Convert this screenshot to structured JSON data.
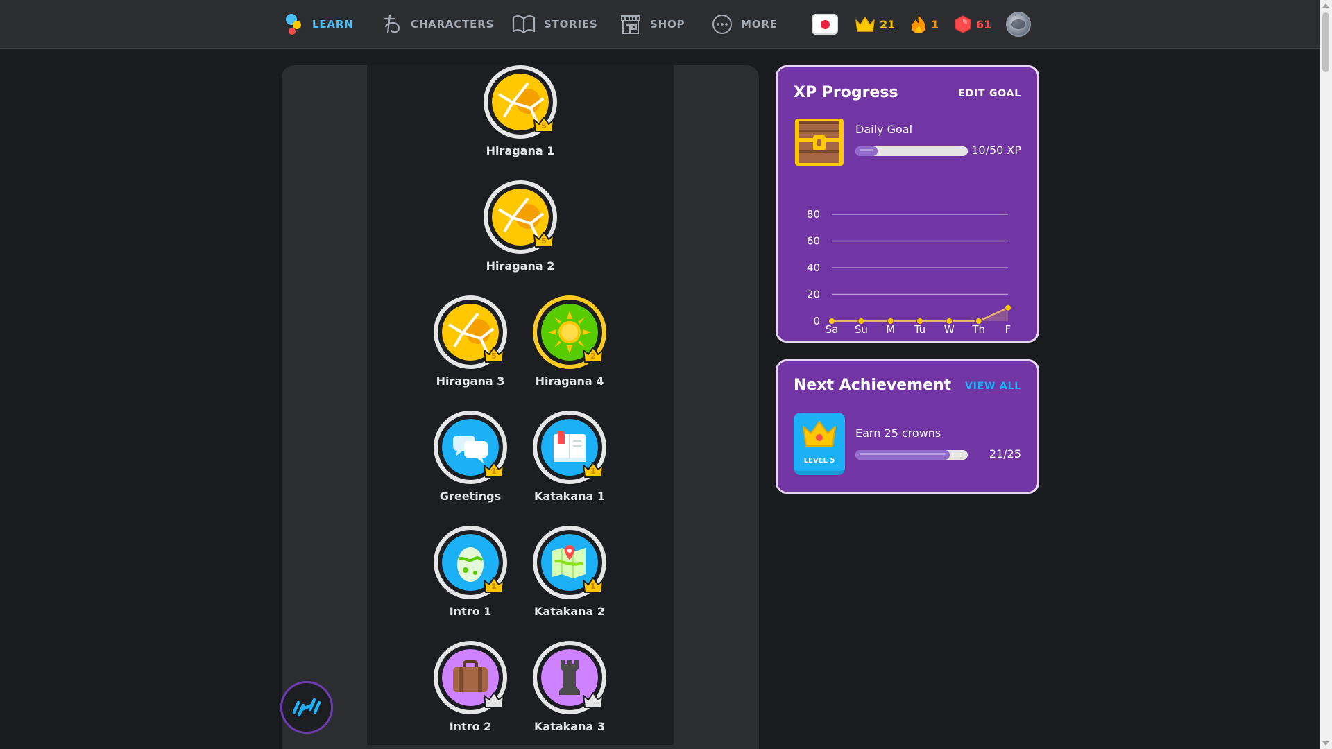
{
  "nav": {
    "items": [
      {
        "label": "LEARN",
        "icon": "learn-icon"
      },
      {
        "label": "CHARACTERS",
        "icon": "characters-icon"
      },
      {
        "label": "STORIES",
        "icon": "stories-icon"
      },
      {
        "label": "SHOP",
        "icon": "shop-icon"
      },
      {
        "label": "MORE",
        "icon": "more-icon"
      }
    ],
    "active": "LEARN",
    "language_flag": "japan-flag-icon",
    "crowns": "21",
    "streak": "1",
    "gems": "61"
  },
  "colors": {
    "active_nav": "#49c0f8",
    "inactive_nav": "#a6acb6",
    "crowns": "#ffc800",
    "streak": "#ff9600",
    "gems": "#ff4b4b",
    "card_bg": "#7135a4",
    "link": "#1cb0f6"
  },
  "skills": [
    {
      "label": "Hiragana 1",
      "icon": "cracked-gold-icon",
      "crown_level": "5"
    },
    {
      "label": "Hiragana 2",
      "icon": "cracked-gold-icon",
      "crown_level": "5"
    },
    {
      "label": "Hiragana 3",
      "icon": "cracked-gold-icon",
      "crown_level": "5"
    },
    {
      "label": "Hiragana 4",
      "icon": "sun-icon",
      "crown_level": "2"
    },
    {
      "label": "Greetings",
      "icon": "speech-bubbles-icon",
      "crown_level": "1"
    },
    {
      "label": "Katakana 1",
      "icon": "book-icon",
      "crown_level": "1"
    },
    {
      "label": "Intro 1",
      "icon": "egg-icon",
      "crown_level": "1"
    },
    {
      "label": "Katakana 2",
      "icon": "map-icon",
      "crown_level": "1"
    },
    {
      "label": "Intro 2",
      "icon": "suitcase-icon",
      "crown_level": ""
    },
    {
      "label": "Katakana 3",
      "icon": "rook-icon",
      "crown_level": ""
    }
  ],
  "practice_button": {
    "icon": "dumbbell-icon"
  },
  "xp_progress": {
    "title": "XP Progress",
    "edit_goal": "EDIT GOAL",
    "goal_label": "Daily Goal",
    "goal_value": "10/50 XP",
    "goal_fraction": 0.2,
    "chest_icon": "treasure-chest-icon"
  },
  "chart_data": {
    "type": "line",
    "categories": [
      "Sa",
      "Su",
      "M",
      "Tu",
      "W",
      "Th",
      "F"
    ],
    "values": [
      0,
      0,
      0,
      0,
      0,
      0,
      10
    ],
    "yticks": [
      0,
      20,
      40,
      60,
      80
    ],
    "ylim": [
      0,
      80
    ],
    "grid": true,
    "line_color": "#e5b567",
    "point_color": "#ffc800"
  },
  "next_achievement": {
    "title": "Next Achievement",
    "view_all": "VIEW ALL",
    "badge_level": "LEVEL 5",
    "badge_icon": "crown-badge-icon",
    "name": "Earn 25 crowns",
    "value": "21/25",
    "fraction": 0.84
  }
}
